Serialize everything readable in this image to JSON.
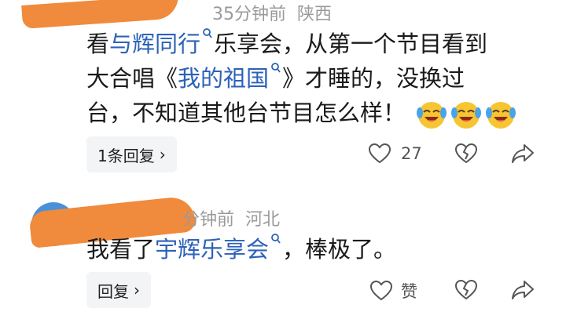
{
  "comments": [
    {
      "time": "35分钟前",
      "location": "陕西",
      "text_parts": {
        "p1": "看",
        "link1": "与辉同行",
        "p2": "乐享会，从第一个节目看到",
        "p3": "大合唱《",
        "link2": "我的祖国",
        "p4": "》才睡的，没换过",
        "p5": "台，不知道其他台节目怎么样！"
      },
      "emojis": [
        "laughing-crying-emoji",
        "laughing-crying-emoji",
        "laughing-crying-emoji"
      ],
      "reply_label": "1条回复",
      "like_count": "27"
    },
    {
      "time": "分钟前",
      "location": "河北",
      "text_parts": {
        "p1": "我看了",
        "link1": "宇辉乐享会",
        "p2": "，棒极了。"
      },
      "reply_label": "回复",
      "like_label": "赞"
    }
  ],
  "colors": {
    "link": "#2c62b8",
    "meta": "#9a9a9a",
    "redaction": "#f08a3c"
  }
}
